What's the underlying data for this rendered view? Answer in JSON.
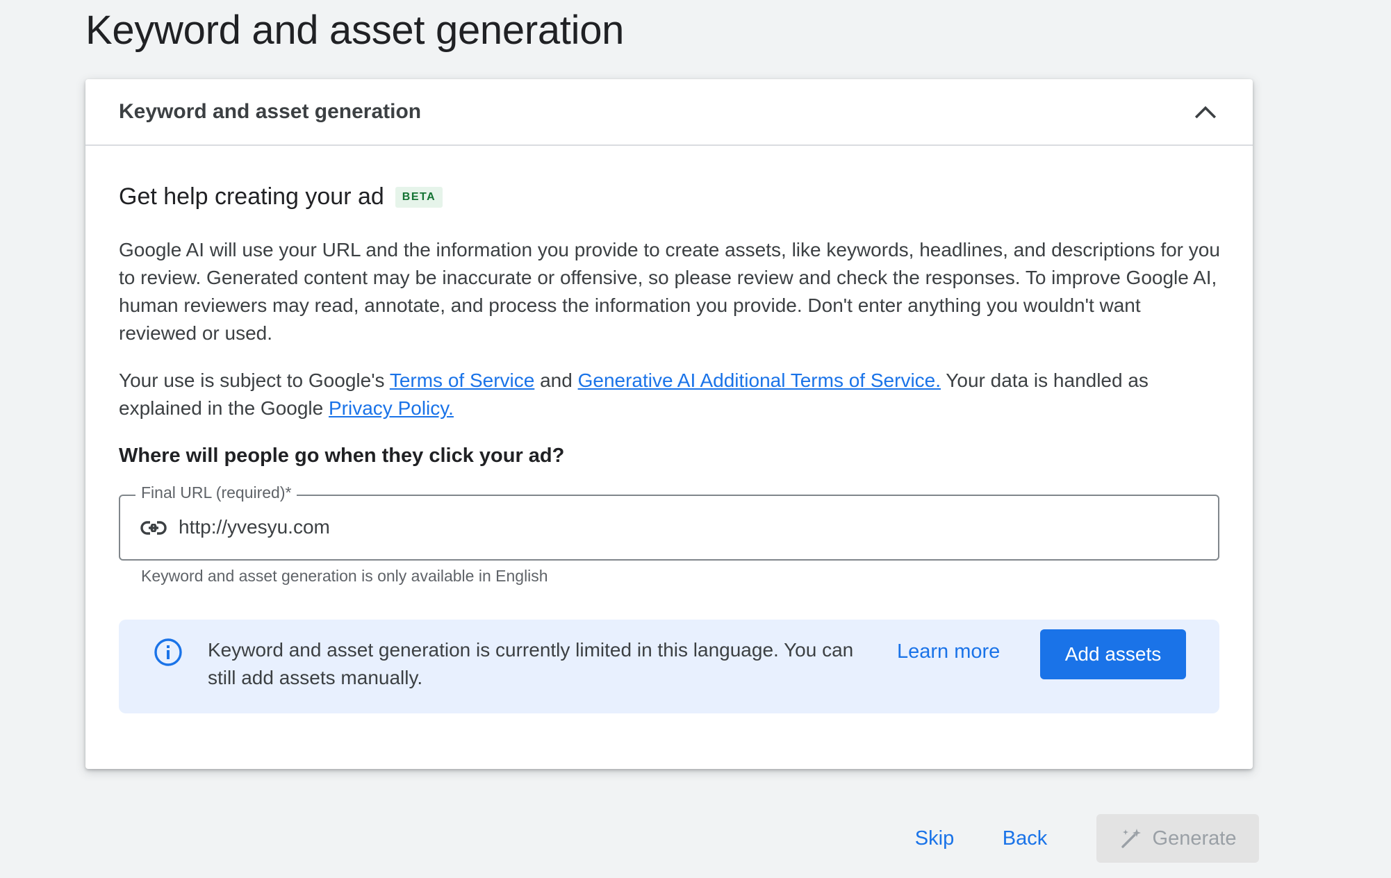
{
  "page": {
    "title": "Keyword and asset generation"
  },
  "card": {
    "header_title": "Keyword and asset generation",
    "collapse_icon": "chevron-up-icon"
  },
  "intro": {
    "heading": "Get help creating your ad",
    "badge": "BETA",
    "paragraph": "Google AI will use your URL and the information you provide to create assets, like keywords, headlines, and descriptions for you to review. Generated content may be inaccurate or offensive, so please review and check the responses. To improve Google AI, human reviewers may read, annotate, and process the information you provide. Don't enter anything you wouldn't want reviewed or used."
  },
  "terms": {
    "prefix": "Your use is subject to Google's ",
    "tos_link": "Terms of Service",
    "and_text": " and ",
    "genai_link": "Generative AI Additional Terms of Service.",
    "middle": " Your data is handled as explained in the Google ",
    "privacy_link": "Privacy Policy."
  },
  "url_section": {
    "question": "Where will people go when they click your ad?",
    "field_label": "Final URL (required)*",
    "field_value": "http://yvesyu.com",
    "field_icon": "link-icon",
    "helper": "Keyword and asset generation is only available in English"
  },
  "banner": {
    "icon": "info-icon",
    "text": "Keyword and asset generation is currently limited in this language. You can still add assets manually.",
    "learn_more": "Learn more",
    "add_assets": "Add assets"
  },
  "footer": {
    "skip": "Skip",
    "back": "Back",
    "generate": "Generate",
    "generate_icon": "magic-wand-icon"
  },
  "colors": {
    "accent": "#1a73e8",
    "background": "#f1f3f4",
    "banner_bg": "#e8f0fe",
    "beta_bg": "#e6f4ea",
    "beta_text": "#137333",
    "disabled_bg": "#e3e3e3",
    "disabled_text": "#9aa0a6"
  }
}
